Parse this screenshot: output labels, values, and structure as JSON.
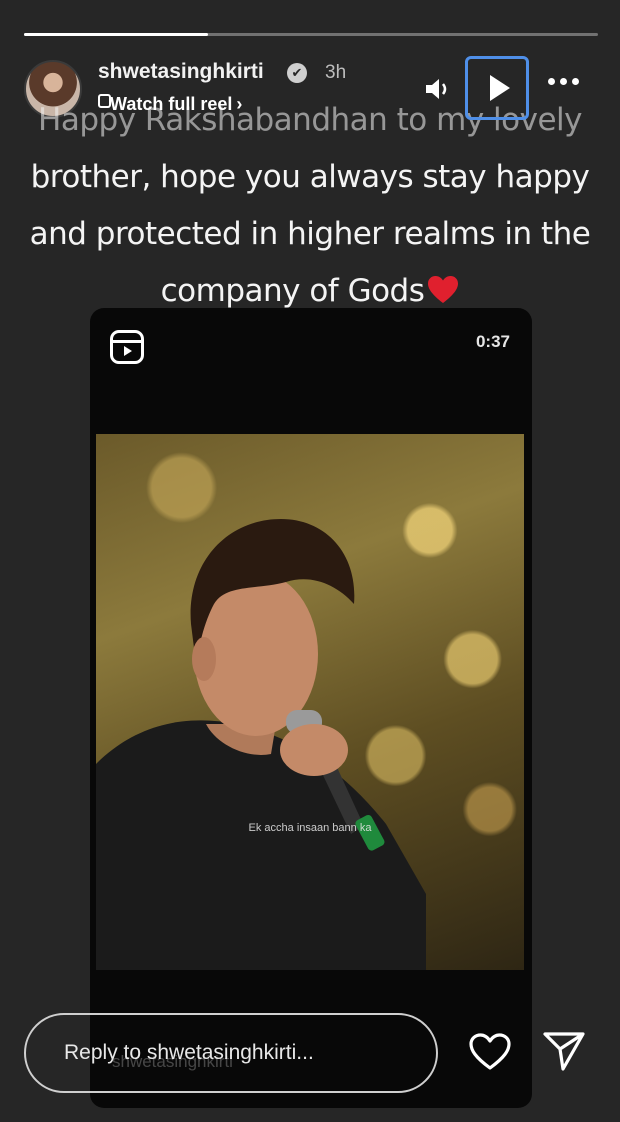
{
  "story": {
    "progress": 0.32,
    "username": "shwetasinghkirti",
    "verified_glyph": "✔",
    "timestamp": "3h",
    "watch_reel": "Watch full reel",
    "watch_reel_chevron": "›"
  },
  "caption": {
    "lines": [
      "Happy Rakshabandhan to my lovely",
      "brother, hope you always stay happy",
      "and protected in higher realms in the",
      "company of Gods"
    ],
    "emoji": "heart-emoji"
  },
  "reel": {
    "duration": "0:37",
    "subtitle": "Ek accha insaan bann ka"
  },
  "footer": {
    "reply_placeholder": "Reply to shwetasinghkirti...",
    "watermark": "shwetasinghkirti"
  },
  "icons": {
    "sound": "speaker-icon",
    "play": "play-icon",
    "more": "more-horizontal-icon",
    "reel": "reels-icon",
    "like": "heart-outline-icon",
    "send": "paper-plane-icon"
  },
  "colors": {
    "background": "#262626",
    "highlight_border": "#4f8fe8",
    "emoji_red": "#e0202e"
  }
}
